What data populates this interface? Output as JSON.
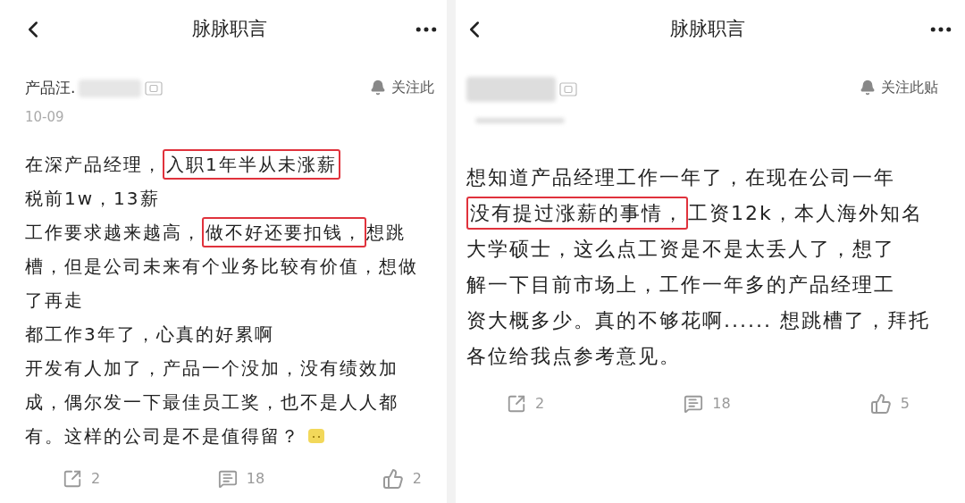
{
  "panels": [
    {
      "header": {
        "title": "脉脉职言"
      },
      "author": {
        "name": "产品汪.",
        "date": "10-09"
      },
      "follow": "关注此",
      "lines": [
        [
          {
            "text": "在深产品经理，",
            "highlighted": false
          },
          {
            "text": "入职1年半从未涨薪",
            "highlighted": true
          }
        ],
        [
          {
            "text": "税前1w，13薪",
            "highlighted": false
          }
        ],
        [
          {
            "text": "工作要求越来越高，",
            "highlighted": false
          },
          {
            "text": "做不好还要扣钱，",
            "highlighted": true
          },
          {
            "text": "想跳",
            "highlighted": false
          }
        ],
        [
          {
            "text": "槽，但是公司未来有个业务比较有价值，想做",
            "highlighted": false
          }
        ],
        [
          {
            "text": "了再走",
            "highlighted": false
          }
        ],
        [
          {
            "text": "都工作3年了，心真的好累啊",
            "highlighted": false
          }
        ],
        [
          {
            "text": "开发有人加了，产品一个没加，没有绩效加",
            "highlighted": false
          }
        ],
        [
          {
            "text": "成，偶尔发一下最佳员工奖，也不是人人都",
            "highlighted": false
          }
        ],
        [
          {
            "text": "有。这样的公司是不是值得留？",
            "highlighted": false
          },
          {
            "kind": "emoji"
          }
        ]
      ],
      "actions": {
        "share": "2",
        "comment": "18",
        "like": "2"
      }
    },
    {
      "header": {
        "title": "脉脉职言"
      },
      "follow": "关注此贴",
      "lines": [
        [
          {
            "text": "想知道产品经理工作一年了，在现在公司一年",
            "highlighted": false
          }
        ],
        [
          {
            "text": "没有提过涨薪的事情，",
            "highlighted": true
          },
          {
            "text": "工资12k，本人海外知名",
            "highlighted": false
          }
        ],
        [
          {
            "text": "大学硕士，这么点工资是不是太丢人了，想了",
            "highlighted": false
          }
        ],
        [
          {
            "text": "解一下目前市场上，工作一年多的产品经理工",
            "highlighted": false
          }
        ],
        [
          {
            "text": "资大概多少。真的不够花啊...... 想跳槽了，拜托",
            "highlighted": false
          }
        ],
        [
          {
            "text": "各位给我点参考意见。",
            "highlighted": false
          }
        ]
      ],
      "actions": {
        "share": "2",
        "comment": "18",
        "like": "5"
      }
    }
  ]
}
